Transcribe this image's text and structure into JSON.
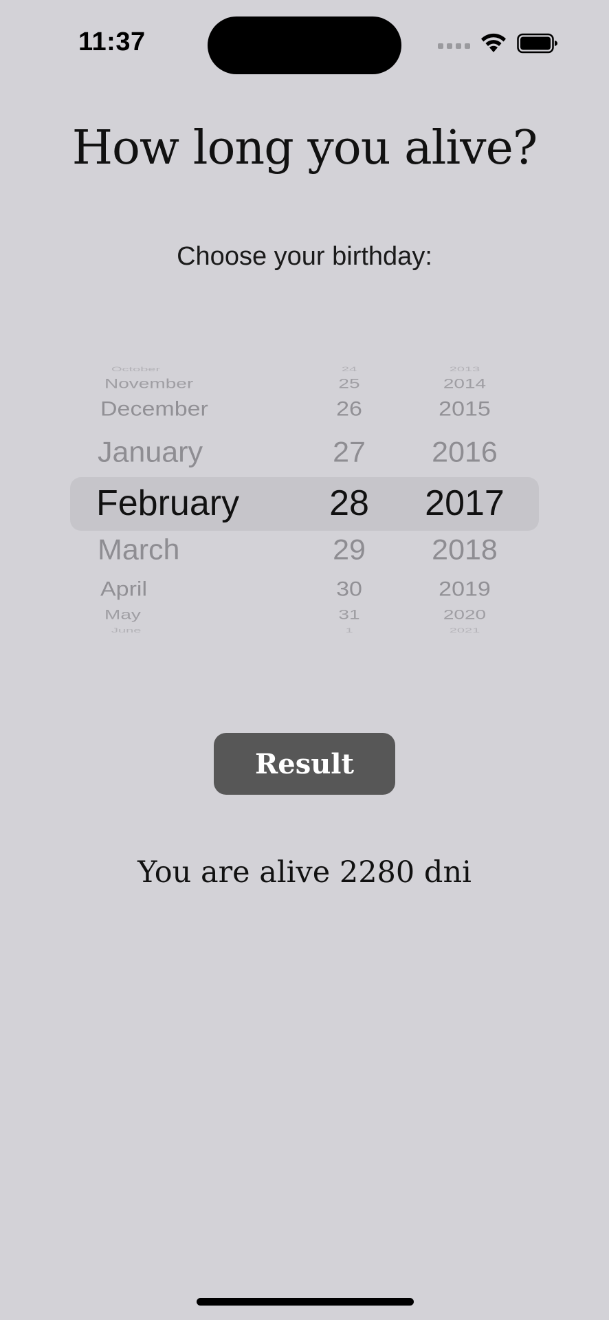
{
  "status_bar": {
    "time": "11:37"
  },
  "title": "How long you alive?",
  "subtitle": "Choose your birthday:",
  "picker": {
    "months": [
      "October",
      "November",
      "December",
      "January",
      "February",
      "March",
      "April",
      "May",
      "June"
    ],
    "days": [
      "24",
      "25",
      "26",
      "27",
      "28",
      "29",
      "30",
      "31",
      "1"
    ],
    "years": [
      "2013",
      "2014",
      "2015",
      "2016",
      "2017",
      "2018",
      "2019",
      "2020",
      "2021"
    ],
    "selected": {
      "month": "February",
      "day": "28",
      "year": "2017"
    }
  },
  "result_button": {
    "label": "Result"
  },
  "result_text": "You are alive 2280 dni",
  "colors": {
    "background": "#d3d2d7",
    "button": "#575757",
    "picker_highlight": "#c6c5ca"
  }
}
